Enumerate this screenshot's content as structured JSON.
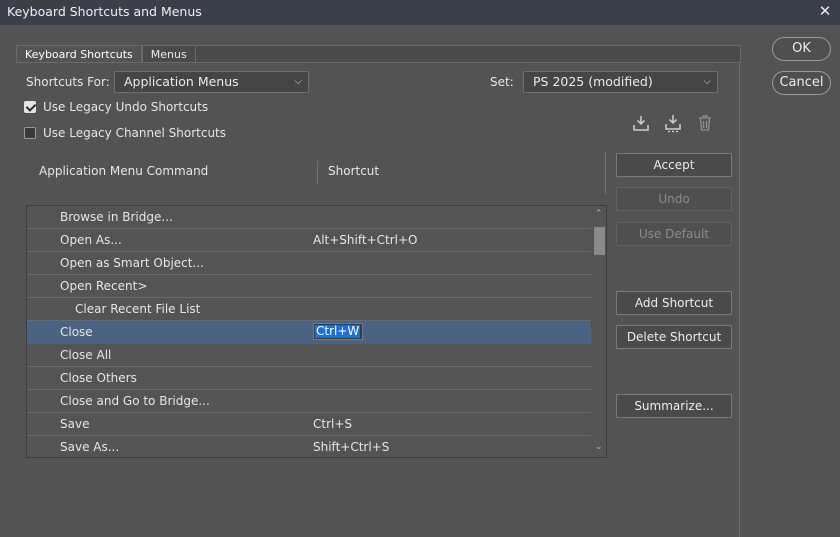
{
  "window": {
    "title": "Keyboard Shortcuts and Menus"
  },
  "tabs": [
    {
      "label": "Keyboard Shortcuts"
    },
    {
      "label": "Menus"
    }
  ],
  "shortcuts_for": {
    "label": "Shortcuts For:",
    "value": "Application Menus"
  },
  "set": {
    "label": "Set:",
    "value": "PS 2025 (modified)"
  },
  "options": {
    "legacy_undo": {
      "label": "Use Legacy Undo Shortcuts",
      "checked": true
    },
    "legacy_channel": {
      "label": "Use Legacy Channel Shortcuts",
      "checked": false
    }
  },
  "icons": [
    "save-set-icon",
    "save-set-as-icon",
    "delete-set-icon"
  ],
  "table": {
    "headers": {
      "command": "Application Menu Command",
      "shortcut": "Shortcut"
    },
    "rows": [
      {
        "command": "Browse in Bridge...",
        "shortcut": ""
      },
      {
        "command": "Open As...",
        "shortcut": "Alt+Shift+Ctrl+O"
      },
      {
        "command": "Open as Smart Object...",
        "shortcut": ""
      },
      {
        "command": "Open Recent>",
        "shortcut": ""
      },
      {
        "command": "Clear Recent File List",
        "shortcut": ""
      },
      {
        "command": "Close",
        "shortcut": "Ctrl+W"
      },
      {
        "command": "Close All",
        "shortcut": ""
      },
      {
        "command": "Close Others",
        "shortcut": ""
      },
      {
        "command": "Close and Go to Bridge...",
        "shortcut": ""
      },
      {
        "command": "Save",
        "shortcut": "Ctrl+S"
      },
      {
        "command": "Save As...",
        "shortcut": "Shift+Ctrl+S"
      }
    ]
  },
  "side_buttons": {
    "accept": "Accept",
    "undo": "Undo",
    "use_default": "Use Default",
    "add_shortcut": "Add Shortcut",
    "delete_shortcut": "Delete Shortcut",
    "summarize": "Summarize..."
  },
  "dialog_buttons": {
    "ok": "OK",
    "cancel": "Cancel"
  },
  "colors": {
    "selection": "#4b6382",
    "edit_highlight": "#1f6fd1",
    "titlebar": "#3a3f49"
  }
}
